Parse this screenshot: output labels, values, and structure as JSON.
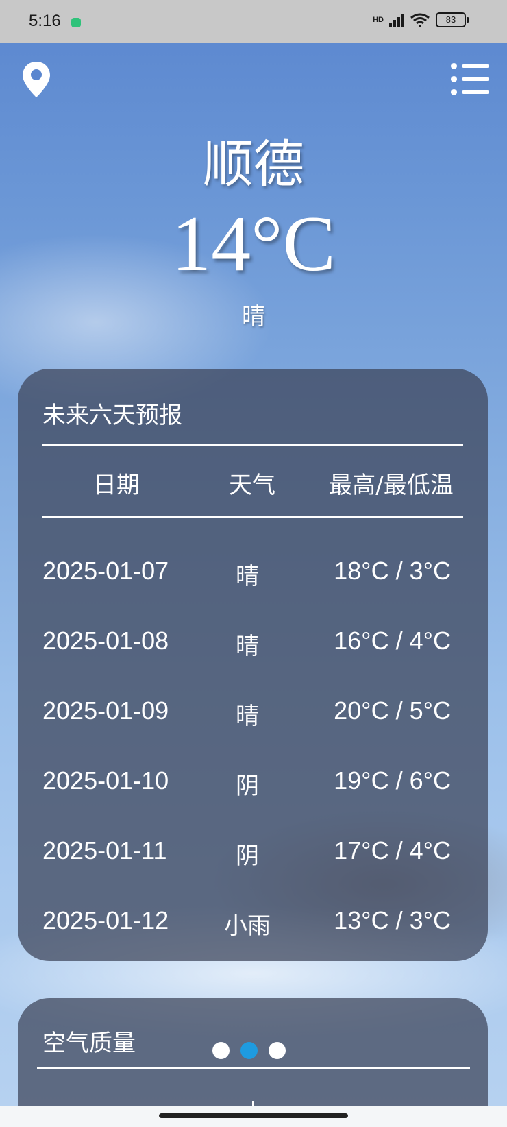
{
  "status_bar": {
    "time": "5:16",
    "network": "HD",
    "battery": "83"
  },
  "weather": {
    "city": "顺德",
    "temperature": "14°C",
    "condition": "晴"
  },
  "forecast": {
    "title": "未来六天预报",
    "headers": {
      "date": "日期",
      "weather": "天气",
      "temps": "最高/最低温"
    },
    "rows": [
      {
        "date": "2025-01-07",
        "weather": "晴",
        "temps": "18°C / 3°C"
      },
      {
        "date": "2025-01-08",
        "weather": "晴",
        "temps": "16°C / 4°C"
      },
      {
        "date": "2025-01-09",
        "weather": "晴",
        "temps": "20°C / 5°C"
      },
      {
        "date": "2025-01-10",
        "weather": "阴",
        "temps": "19°C / 6°C"
      },
      {
        "date": "2025-01-11",
        "weather": "阴",
        "temps": "17°C / 4°C"
      },
      {
        "date": "2025-01-12",
        "weather": "小雨",
        "temps": "13°C / 3°C"
      }
    ]
  },
  "air_quality": {
    "title": "空气质量"
  },
  "pager": {
    "count": 3,
    "active_index": 1,
    "active_color": "#1e9be0"
  },
  "icons": {
    "location": "location-pin-icon",
    "menu": "list-menu-icon"
  }
}
